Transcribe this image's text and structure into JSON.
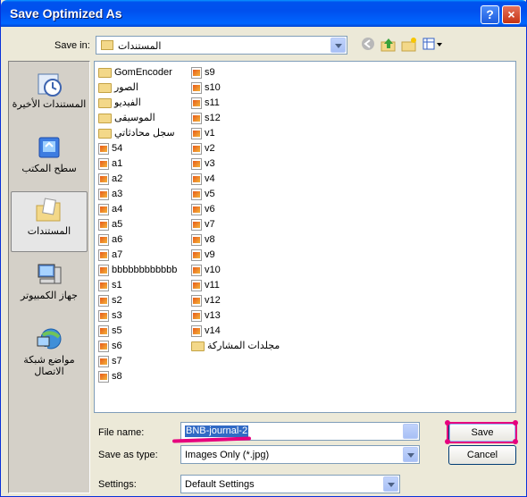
{
  "window": {
    "title": "Save Optimized As",
    "help_label": "?",
    "close_label": "×"
  },
  "savein": {
    "label": "Save in:",
    "value": "المستندات"
  },
  "places": [
    {
      "label": "المستندات الأخيرة",
      "icon": "recent-documents-icon"
    },
    {
      "label": "سطح المكتب",
      "icon": "desktop-icon"
    },
    {
      "label": "المستندات",
      "icon": "my-documents-icon",
      "selected": true
    },
    {
      "label": "جهاز الكمبيوتر",
      "icon": "my-computer-icon"
    },
    {
      "label": "مواضع شبكة الاتصال",
      "icon": "network-places-icon"
    }
  ],
  "files_col1": [
    {
      "name": "GomEncoder",
      "type": "folder"
    },
    {
      "name": "الصور",
      "type": "folder-pictures"
    },
    {
      "name": "الفيديو",
      "type": "folder-video"
    },
    {
      "name": "الموسيقى",
      "type": "folder-music"
    },
    {
      "name": "سجل محادثاتي",
      "type": "folder"
    },
    {
      "name": "54",
      "type": "jpg"
    },
    {
      "name": "a1",
      "type": "jpg"
    },
    {
      "name": "a2",
      "type": "jpg"
    },
    {
      "name": "a3",
      "type": "jpg"
    },
    {
      "name": "a4",
      "type": "jpg"
    },
    {
      "name": "a5",
      "type": "jpg"
    },
    {
      "name": "a6",
      "type": "jpg"
    },
    {
      "name": "a7",
      "type": "jpg"
    },
    {
      "name": "bbbbbbbbbbbb",
      "type": "jpg"
    },
    {
      "name": "s1",
      "type": "jpg"
    },
    {
      "name": "s2",
      "type": "jpg"
    },
    {
      "name": "s3",
      "type": "jpg"
    },
    {
      "name": "s5",
      "type": "jpg"
    },
    {
      "name": "s6",
      "type": "jpg"
    },
    {
      "name": "s7",
      "type": "jpg"
    },
    {
      "name": "s8",
      "type": "jpg"
    }
  ],
  "files_col2": [
    {
      "name": "s9",
      "type": "jpg"
    },
    {
      "name": "s10",
      "type": "jpg"
    },
    {
      "name": "s11",
      "type": "jpg"
    },
    {
      "name": "s12",
      "type": "jpg"
    },
    {
      "name": "v1",
      "type": "jpg"
    },
    {
      "name": "v2",
      "type": "jpg"
    },
    {
      "name": "v3",
      "type": "jpg"
    },
    {
      "name": "v4",
      "type": "jpg"
    },
    {
      "name": "v5",
      "type": "jpg"
    },
    {
      "name": "v6",
      "type": "jpg"
    },
    {
      "name": "v7",
      "type": "jpg"
    },
    {
      "name": "v8",
      "type": "jpg"
    },
    {
      "name": "v9",
      "type": "jpg"
    },
    {
      "name": "v10",
      "type": "jpg"
    },
    {
      "name": "v11",
      "type": "jpg"
    },
    {
      "name": "v12",
      "type": "jpg"
    },
    {
      "name": "v13",
      "type": "jpg"
    },
    {
      "name": "v14",
      "type": "jpg"
    },
    {
      "name": "مجلدات المشاركة",
      "type": "folder-shared"
    }
  ],
  "filename": {
    "label": "File name:",
    "value": "BNB-journal-2"
  },
  "savetype": {
    "label": "Save as type:",
    "value": "Images Only (*.jpg)"
  },
  "settings": {
    "label": "Settings:",
    "value": "Default Settings"
  },
  "buttons": {
    "save": "Save",
    "cancel": "Cancel"
  },
  "colors": {
    "titlebar": "#0054e3",
    "annotation": "#e6007e",
    "selection": "#316ac5"
  }
}
